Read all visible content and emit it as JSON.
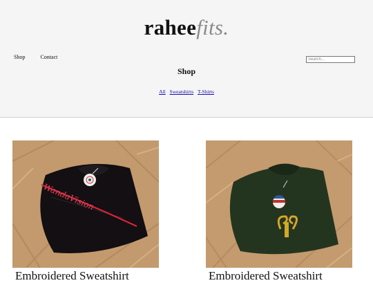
{
  "brand": {
    "name_main": "rahee",
    "name_accent": "fits."
  },
  "nav": {
    "items": [
      "Shop",
      "Contact"
    ]
  },
  "search": {
    "placeholder": "Search..."
  },
  "shop": {
    "title": "Shop",
    "filters": [
      "All",
      "Sweatshirts",
      "T-Shirts"
    ]
  },
  "products": [
    {
      "title": "Embroidered Sweatshirt",
      "embroidery_text": "WandaVision",
      "shirt_color": "#121214",
      "embroidery_color": "#d8233a"
    },
    {
      "title": "Embroidered Sweatshirt",
      "shirt_color": "#24351f",
      "embroidery_color": "#d4a62a"
    }
  ]
}
